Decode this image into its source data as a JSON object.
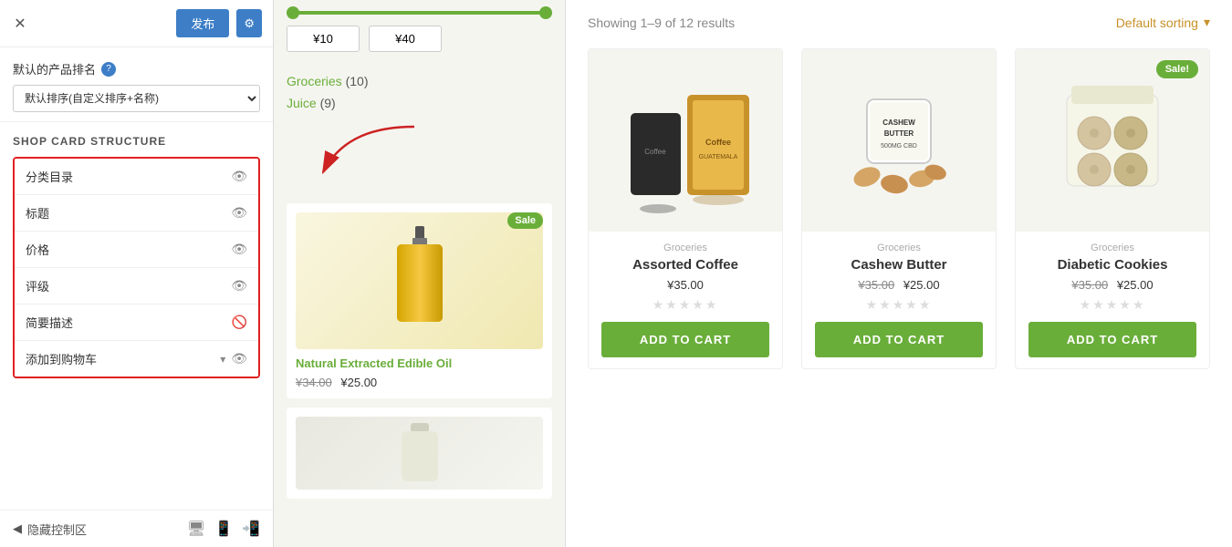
{
  "topbar": {
    "close_label": "✕",
    "publish_label": "发布",
    "gear_label": "⚙"
  },
  "sort": {
    "label": "默认的产品排名",
    "option": "默认排序(自定义排序+名称)"
  },
  "shop_card": {
    "title": "SHOP CARD STRUCTURE",
    "items": [
      {
        "label": "分类目录",
        "icon": "eye",
        "visible": true
      },
      {
        "label": "标题",
        "icon": "eye",
        "visible": true
      },
      {
        "label": "价格",
        "icon": "eye",
        "visible": true
      },
      {
        "label": "评级",
        "icon": "eye",
        "visible": true
      },
      {
        "label": "简要描述",
        "icon": "eye-off",
        "visible": false
      },
      {
        "label": "添加到购物车",
        "icon": "eye",
        "visible": true,
        "hasChevron": true
      }
    ]
  },
  "bottom_bar": {
    "hide_label": "隐藏控制区",
    "prev_icon": "◀"
  },
  "price_range": {
    "min": "¥10",
    "max": "¥40"
  },
  "filters": [
    {
      "name": "Groceries",
      "count": "(10)"
    },
    {
      "name": "Juice",
      "count": "(9)"
    }
  ],
  "middle_product": {
    "badge": "Sale",
    "name": "Natural Extracted Edible Oil",
    "old_price": "¥34.00",
    "new_price": "¥25.00"
  },
  "results": {
    "text": "Showing 1–9 of 12 results",
    "sorting_label": "Default sorting",
    "sorting_icon": "▾"
  },
  "products": [
    {
      "category": "Groceries",
      "title": "Assorted Coffee",
      "price_old": "",
      "price_new": "¥35.00",
      "sale": false,
      "add_to_cart": "ADD TO CART"
    },
    {
      "category": "Groceries",
      "title": "Cashew Butter",
      "price_old": "¥35.00",
      "price_new": "¥25.00",
      "sale": false,
      "add_to_cart": "ADD TO CART"
    },
    {
      "category": "Groceries",
      "title": "Diabetic Cookies",
      "price_old": "¥35.00",
      "price_new": "¥25.00",
      "sale": true,
      "add_to_cart": "ADD TO CART"
    }
  ]
}
